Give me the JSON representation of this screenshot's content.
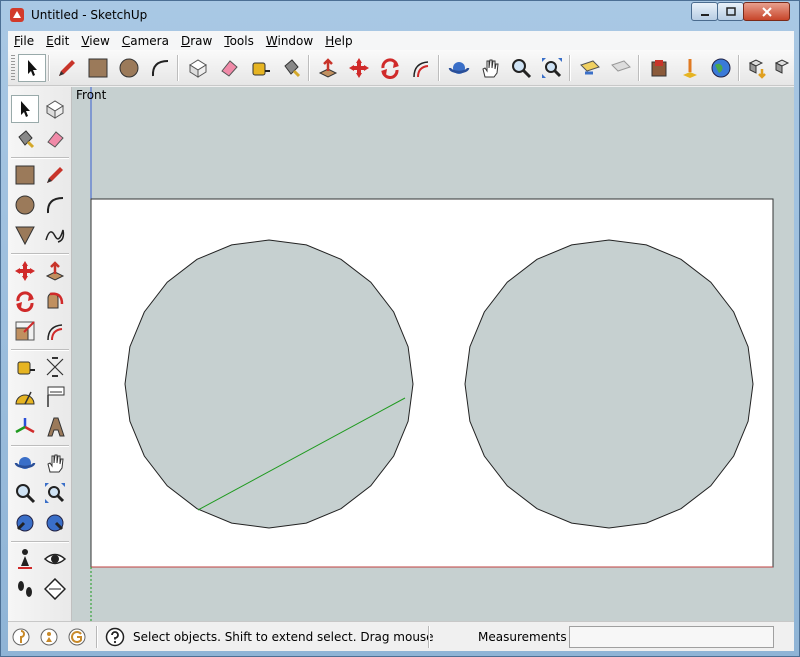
{
  "window": {
    "title": "Untitled - SketchUp"
  },
  "menu": {
    "items": [
      {
        "key": "F",
        "rest": "ile"
      },
      {
        "key": "E",
        "rest": "dit"
      },
      {
        "key": "V",
        "rest": "iew"
      },
      {
        "key": "C",
        "rest": "amera"
      },
      {
        "key": "D",
        "rest": "raw"
      },
      {
        "key": "T",
        "rest": "ools"
      },
      {
        "key": "W",
        "rest": "indow"
      },
      {
        "key": "H",
        "rest": "elp"
      }
    ]
  },
  "viewport": {
    "view_label": "Front"
  },
  "statusbar": {
    "help_text": "Select objects. Shift to extend select. Drag mouse",
    "measurements_label": "Measurements",
    "measurements_value": ""
  },
  "colors": {
    "viewport_bg": "#c6d0d0",
    "paper": "#ffffff",
    "circle_fill": "#c6d0d0",
    "edge": "#222222",
    "green_axis": "#1f9a1f"
  }
}
